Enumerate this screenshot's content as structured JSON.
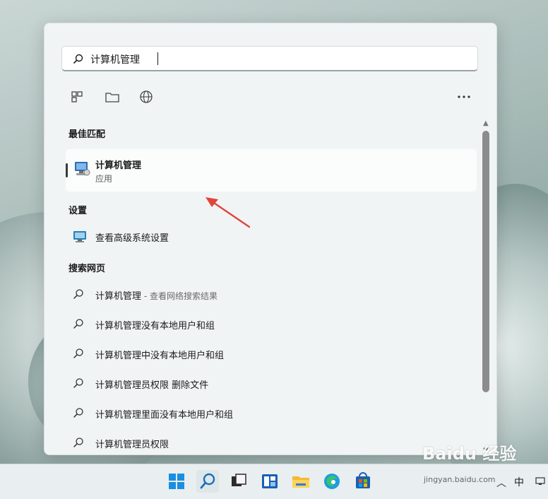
{
  "search": {
    "query": "计算机管理"
  },
  "sections": {
    "best_match": "最佳匹配",
    "settings": "设置",
    "web": "搜索网页"
  },
  "best_match": {
    "title": "计算机管理",
    "subtitle": "应用"
  },
  "settings_items": [
    {
      "label": "查看高级系统设置"
    }
  ],
  "web_results": [
    {
      "label": "计算机管理",
      "suffix": " - 查看网络搜索结果"
    },
    {
      "label": "计算机管理没有本地用户和组"
    },
    {
      "label": "计算机管理中没有本地用户和组"
    },
    {
      "label": "计算机管理员权限 删除文件"
    },
    {
      "label": "计算机管理里面没有本地用户和组"
    },
    {
      "label": "计算机管理员权限"
    }
  ],
  "tray": {
    "ime": "中"
  },
  "watermark": {
    "brand": "Baidu 经验",
    "url": "jingyan.baidu.com"
  },
  "icons": {
    "toolbar": [
      "apps-icon",
      "folder-icon",
      "globe-icon",
      "more-icon"
    ],
    "taskbar": [
      "windows-start-icon",
      "search-icon",
      "task-view-icon",
      "widgets-icon",
      "file-explorer-icon",
      "edge-icon",
      "store-icon"
    ]
  },
  "colors": {
    "accent_arrow": "#e0453a",
    "panel_bg": "#f1f4f5",
    "taskbar_bg": "#e9eef0"
  }
}
